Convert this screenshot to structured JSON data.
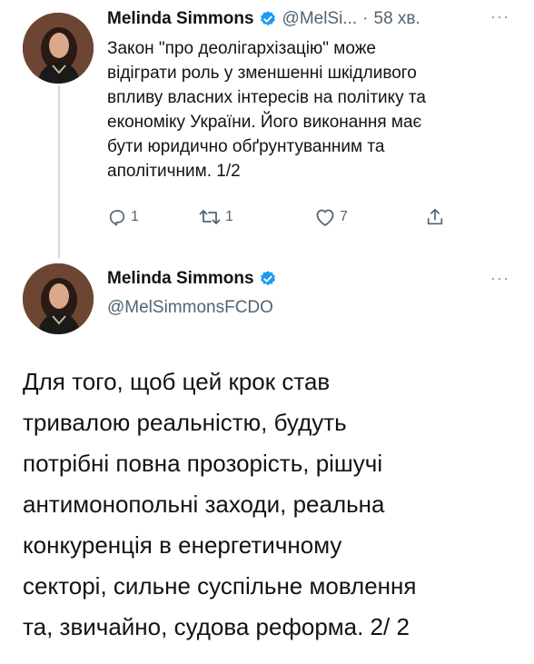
{
  "tweet1": {
    "author_name": "Melinda Simmons",
    "handle": "@MelSi...",
    "separator": "·",
    "time": "58 хв.",
    "more": "···",
    "text_lines": [
      "Закон \"про деолігархізацію\" може",
      "відіграти роль у зменшенні шкідливого",
      "впливу власних інтересів на політику та",
      "економіку України. Його виконання має",
      "бути юридично обґрунтуванним та",
      "аполітичним. 1/2"
    ],
    "actions": {
      "reply_count": "1",
      "retweet_count": "1",
      "like_count": "7"
    }
  },
  "tweet2": {
    "author_name": "Melinda Simmons",
    "handle": "@MelSimmonsFCDO",
    "more": "···",
    "text_lines": [
      "Для того, щоб цей крок став",
      "тривалою реальністю, будуть",
      "потрібні повна прозорість, рішучі",
      "антимонопольні заходи, реальна",
      "конкуренція в енергетичному",
      "секторі, сильне суспільне мовлення",
      "та, звичайно, судова реформа. 2/ 2"
    ]
  },
  "icons": {
    "verified": "verified-badge-icon",
    "reply": "reply-icon",
    "retweet": "retweet-icon",
    "like": "heart-icon",
    "share": "share-icon"
  },
  "colors": {
    "verified_blue": "#1d9bf0",
    "secondary_text": "#536471",
    "thread_line": "#cfd9de"
  }
}
